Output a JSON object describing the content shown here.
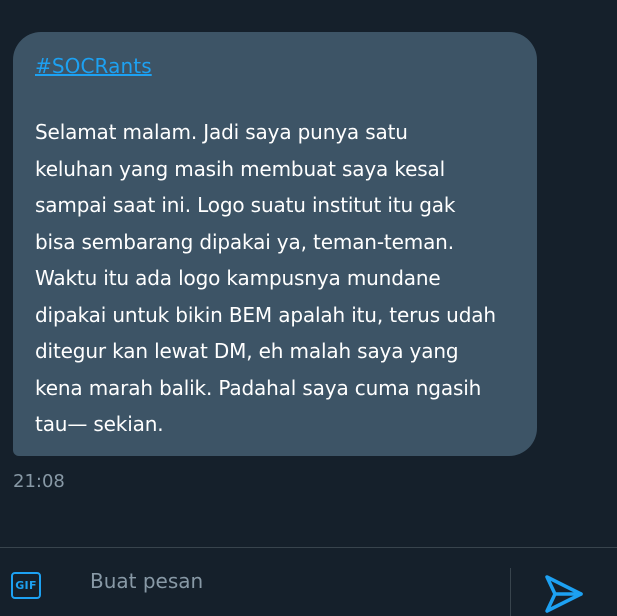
{
  "message": {
    "hashtag": "#SOCRants",
    "body": "Selamat malam. Jadi saya punya satu\nkeluhan yang masih membuat saya kesal\nsampai saat ini. Logo suatu institut itu gak\nbisa sembarang dipakai ya, teman-teman.\nWaktu itu ada logo kampusnya mundane\ndipakai untuk bikin BEM apalah itu, terus udah\nditegur kan lewat DM, eh malah saya yang\nkena marah balik. Padahal saya cuma ngasih\ntau— sekian.",
    "timestamp": "21:08"
  },
  "composer": {
    "gif_label": "GIF",
    "placeholder": "Buat pesan",
    "value": "",
    "send_icon": "send-icon"
  },
  "colors": {
    "background": "#15202b",
    "bubble": "#3d5466",
    "accent": "#1da1f2",
    "muted_text": "#8899a6",
    "divider": "#38444d"
  }
}
